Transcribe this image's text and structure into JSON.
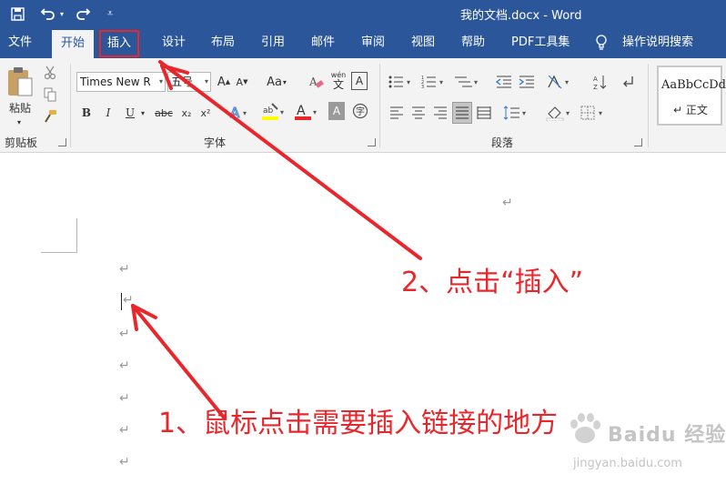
{
  "titlebar": {
    "save_icon": "save-icon",
    "undo_icon": "undo-icon",
    "redo_icon": "redo-icon",
    "customize_icon": "customize-quick-access-icon",
    "title": "我的文档.docx  -  Word",
    "bg": "#2b579a"
  },
  "tabs": [
    {
      "label": "文件"
    },
    {
      "label": "开始"
    },
    {
      "label": "插入"
    },
    {
      "label": "设计"
    },
    {
      "label": "布局"
    },
    {
      "label": "引用"
    },
    {
      "label": "邮件"
    },
    {
      "label": "审阅"
    },
    {
      "label": "视图"
    },
    {
      "label": "帮助"
    },
    {
      "label": "PDF工具集"
    },
    {
      "label": "操作说明搜索"
    }
  ],
  "ribbon": {
    "clipboard": {
      "paste_label": "粘贴",
      "group_label": "剪贴板"
    },
    "font": {
      "font_name": "Times New R",
      "font_size": "五号",
      "bold": "B",
      "italic": "I",
      "underline": "U",
      "strike": "abc",
      "subscript": "x₂",
      "superscript": "x²",
      "grow": "A",
      "shrink": "A",
      "case": "Aa",
      "phonetic_top": "wén",
      "phonetic_bottom": "文",
      "border_char": "A",
      "group_label": "字体"
    },
    "paragraph": {
      "group_label": "段落"
    },
    "styles": {
      "preview": "AaBbCcDd",
      "name": "↵ 正文"
    }
  },
  "annotations": {
    "step1": "1、鼠标点击需要插入链接的地方",
    "step2": "2、点击“插入”",
    "color": "#e8262b"
  },
  "watermark": {
    "brand": "Baidu 经验",
    "url": "jingyan.baidu.com"
  }
}
